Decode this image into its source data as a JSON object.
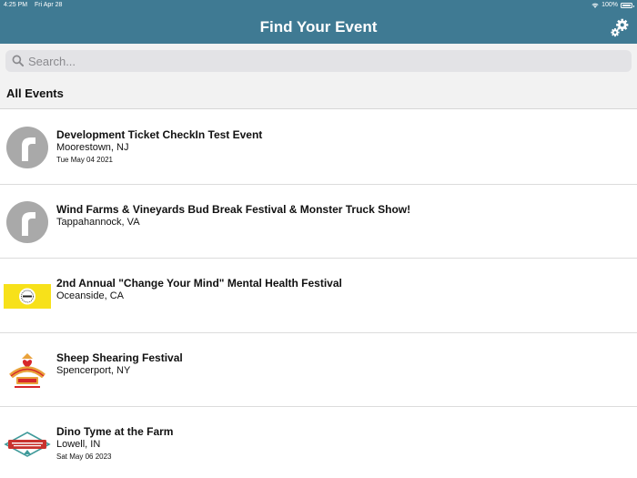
{
  "status_bar": {
    "time": "4:25 PM",
    "date": "Fri Apr 28",
    "battery": "100%"
  },
  "nav": {
    "title": "Find Your Event",
    "settings_icon": "gear-icon"
  },
  "search": {
    "placeholder": "Search...",
    "value": ""
  },
  "section": {
    "title": "All Events"
  },
  "events": [
    {
      "title": "Development Ticket CheckIn Test Event",
      "location": "Moorestown, NJ",
      "date": "Tue May 04 2021",
      "thumbnail": "default-logo"
    },
    {
      "title": "Wind Farms & Vineyards Bud Break Festival & Monster Truck Show!",
      "location": "Tappahannock, VA",
      "date": "",
      "thumbnail": "default-logo"
    },
    {
      "title": "2nd Annual \"Change Your Mind\" Mental Health Festival",
      "location": "Oceanside, CA",
      "date": "",
      "thumbnail": "yellow-event-banner"
    },
    {
      "title": "Sheep Shearing Festival",
      "location": "Spencerport, NY",
      "date": "",
      "thumbnail": "farm-logo"
    },
    {
      "title": "Dino Tyme at the Farm",
      "location": "Lowell, IN",
      "date": "Sat May 06 2023",
      "thumbnail": "harvest-tyme-logo"
    }
  ],
  "colors": {
    "header_bg": "#3f7a93",
    "search_bg": "#e3e3e6",
    "section_bg": "#f2f2f2"
  }
}
